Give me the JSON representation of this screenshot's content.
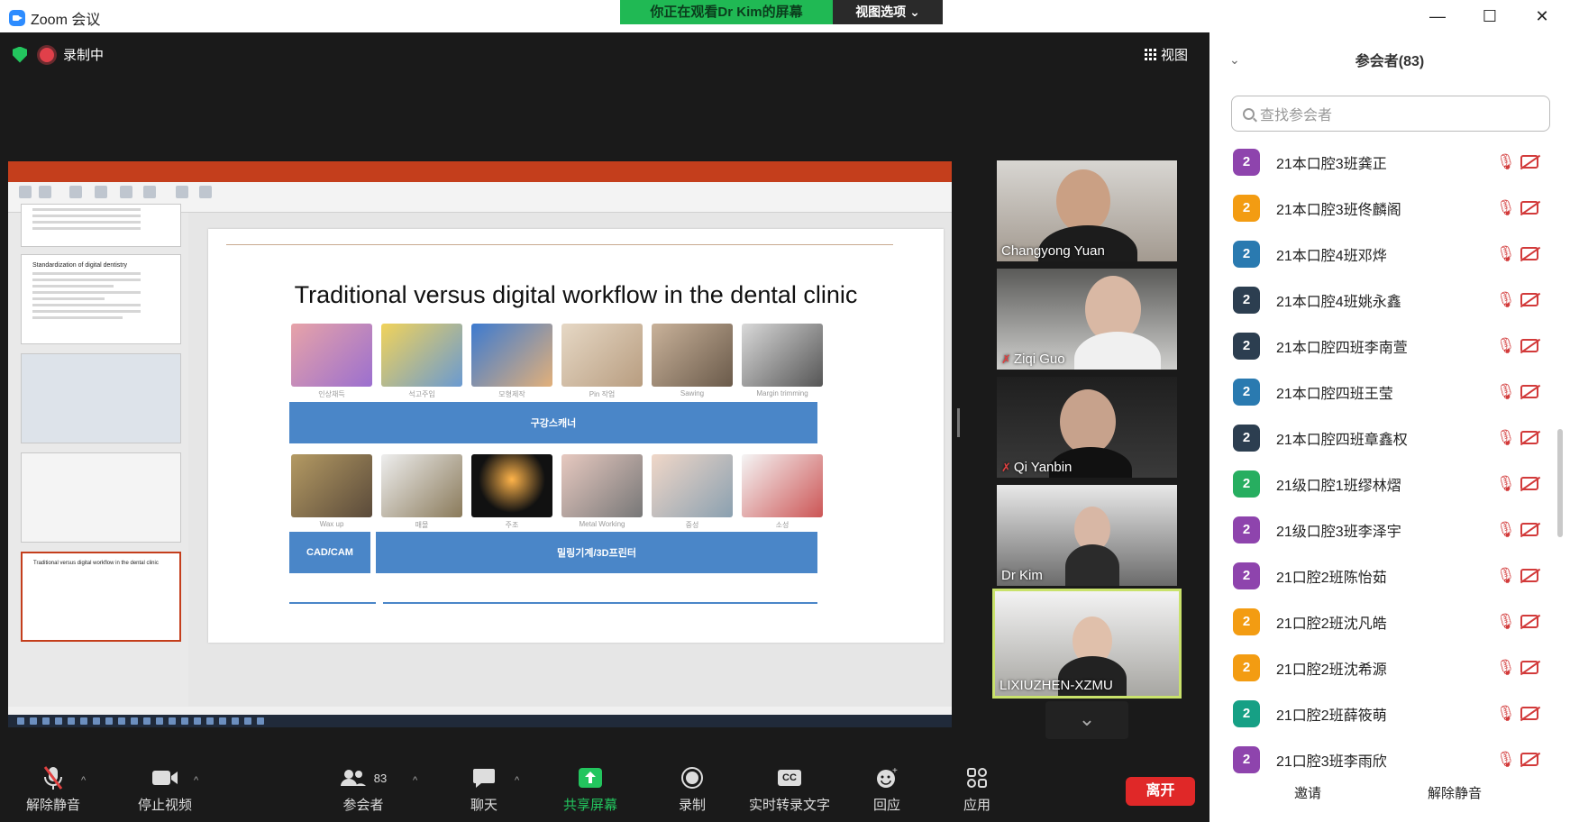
{
  "titlebar": {
    "app_title": "Zoom 会议",
    "viewing_banner": "你正在观看Dr Kim的屏幕",
    "view_options": "视图选项 ⌄"
  },
  "meeting": {
    "recording_label": "录制中",
    "view_label": "视图"
  },
  "shared_screen": {
    "slide_title": "Traditional versus digital workflow in the dental clinic",
    "thumb_titles": [
      "Standardization of digital dentistry",
      "Traditional versus digital workflow in the dental clinic"
    ],
    "row1_captions": [
      "인상채득",
      "석고주입",
      "모형제작",
      "Pin 작업",
      "Sawing",
      "Margin trimming"
    ],
    "scanner_bar": "구강스캐너",
    "row2_captions": [
      "Wax up",
      "매몰",
      "주조",
      "Metal Working",
      "중성",
      "소성"
    ],
    "cadcam_label": "CAD/CAM",
    "mill_bar": "밀링기계/3D프린터"
  },
  "videos": [
    {
      "name": "Changyong Yuan",
      "muted": false
    },
    {
      "name": "Ziqi Guo",
      "muted": true
    },
    {
      "name": "Qi Yanbin",
      "muted": true
    },
    {
      "name": "Dr Kim",
      "muted": false
    },
    {
      "name": "LIXIUZHEN-XZMU",
      "muted": false
    }
  ],
  "toolbar": {
    "unmute": "解除静音",
    "stop_video": "停止视频",
    "participants": "参会者",
    "participant_count": "83",
    "chat": "聊天",
    "share": "共享屏幕",
    "record": "录制",
    "captions": "实时转录文字",
    "cc_badge": "CC",
    "reactions": "回应",
    "apps": "应用",
    "leave": "离开"
  },
  "panel": {
    "header": "参会者(83)",
    "search_placeholder": "查找参会者",
    "invite": "邀请",
    "unmute_all": "解除静音",
    "participants": [
      {
        "badge": "2",
        "name": "21本口腔3班龚正",
        "color": "#8e44ad"
      },
      {
        "badge": "2",
        "name": "21本口腔3班佟麟阁",
        "color": "#f39c12"
      },
      {
        "badge": "2",
        "name": "21本口腔4班邓烨",
        "color": "#2a7ab0"
      },
      {
        "badge": "2",
        "name": "21本口腔4班姚永鑫",
        "color": "#2c3e50"
      },
      {
        "badge": "2",
        "name": "21本口腔四班李南萱",
        "color": "#2c3e50"
      },
      {
        "badge": "2",
        "name": "21本口腔四班王莹",
        "color": "#2a7ab0"
      },
      {
        "badge": "2",
        "name": "21本口腔四班章鑫权",
        "color": "#2c3e50"
      },
      {
        "badge": "2",
        "name": "21级口腔1班缪林熠",
        "color": "#27ae60"
      },
      {
        "badge": "2",
        "name": "21级口腔3班李泽宇",
        "color": "#8e44ad"
      },
      {
        "badge": "2",
        "name": "21口腔2班陈怡茹",
        "color": "#8e44ad"
      },
      {
        "badge": "2",
        "name": "21口腔2班沈凡皓",
        "color": "#f39c12"
      },
      {
        "badge": "2",
        "name": "21口腔2班沈希源",
        "color": "#f39c12"
      },
      {
        "badge": "2",
        "name": "21口腔2班薛筱萌",
        "color": "#16a085"
      },
      {
        "badge": "2",
        "name": "21口腔3班李雨欣",
        "color": "#8e44ad"
      }
    ]
  }
}
